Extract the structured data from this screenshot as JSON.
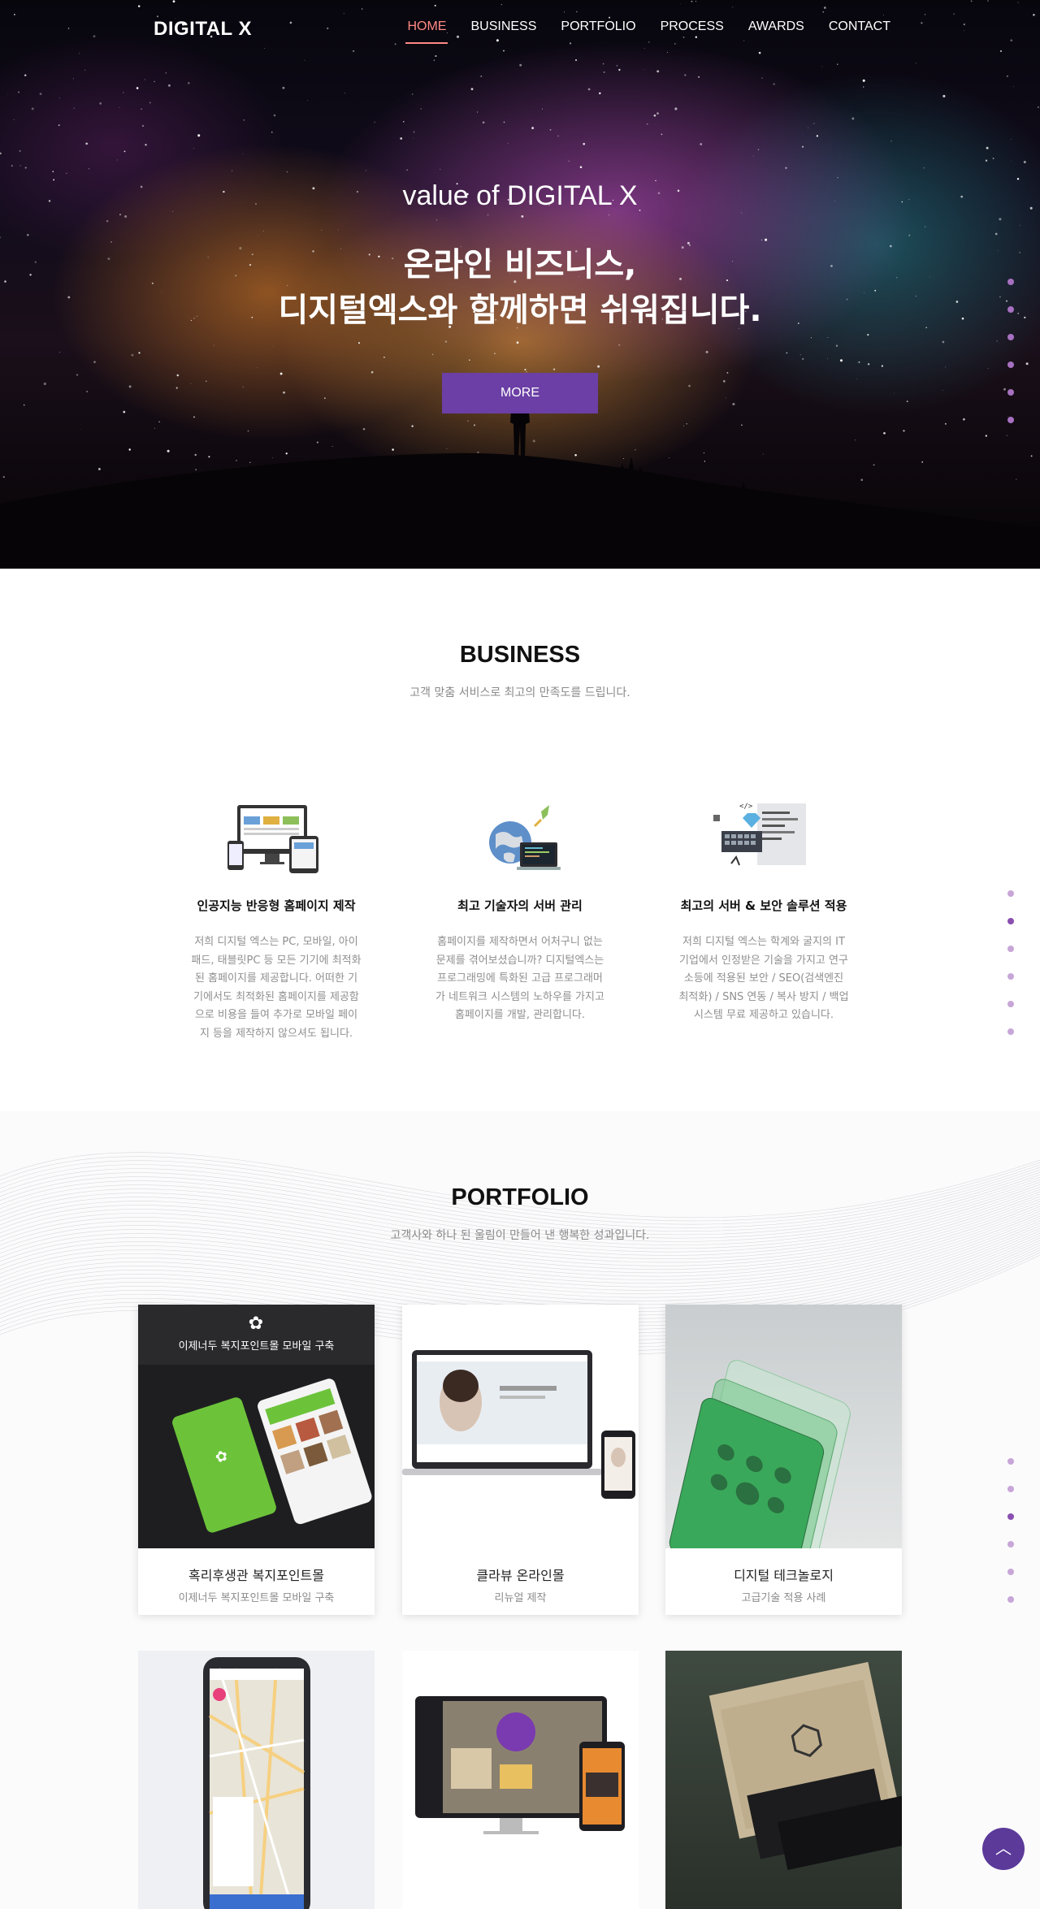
{
  "nav": {
    "logo": "DIGITAL X",
    "items": [
      {
        "label": "HOME",
        "active": true
      },
      {
        "label": "BUSINESS",
        "active": false
      },
      {
        "label": "PORTFOLIO",
        "active": false
      },
      {
        "label": "PROCESS",
        "active": false
      },
      {
        "label": "AWARDS",
        "active": false
      },
      {
        "label": "CONTACT",
        "active": false
      }
    ]
  },
  "hero": {
    "subtitle": "value of DIGITAL X",
    "title_line1": "온라인 비즈니스,",
    "title_line2": "디지털엑스와 함께하면 쉬워집니다.",
    "button": "MORE"
  },
  "business": {
    "title": "BUSINESS",
    "subtitle": "고객 맞춤 서비스로 최고의 만족도를 드립니다.",
    "cards": [
      {
        "icon": "responsive-devices-icon",
        "title": "인공지능 반응형 홈페이지 제작",
        "text": "저희 디지털 엑스는 PC, 모바일, 아이패드, 태블릿PC 등 모든 기기에 최적화된 홈페이지를 제공합니다. 어떠한 기기에서도 최적화된 홈페이지를 제공함으로 비용을 들여 추가로 모바일 페이지 등을 제작하지 않으셔도 됩니다."
      },
      {
        "icon": "globe-server-icon",
        "title": "최고 기술자의 서버 관리",
        "text": "홈페이지를 제작하면서 어처구니 없는 문제를 겪어보셨습니까? 디지털엑스는 프로그래밍에 특화된 고급 프로그래머가 네트워크 시스템의 노하우를 가지고 홈페이지를 개발, 관리합니다."
      },
      {
        "icon": "code-security-icon",
        "title": "최고의 서버 & 보안 솔루션 적용",
        "text": "저희 디지털 엑스는 학계와 굴지의 IT 기업에서 인정받은 기술을 가지고 연구소등에 적용된 보안 / SEO(검색엔진 최적화) / SNS 연동 / 복사 방지 / 백업 시스템 무료 제공하고 있습니다."
      }
    ]
  },
  "portfolio": {
    "title": "PORTFOLIO",
    "subtitle": "고객사와 하나 된 울림이 만들어 낸 행복한 성과입니다.",
    "items": [
      {
        "banner": "이제너두 복지포인트몰 모바일 구축",
        "title": "혹리후생관 복지포인트몰",
        "desc": "이제너두 복지포인트몰 모바일 구축"
      },
      {
        "title": "클라뷰 온라인몰",
        "desc": "리뉴얼 제작"
      },
      {
        "title": "디지털 테크놀로지",
        "desc": "고급기술 적용 사례"
      },
      {
        "title": "",
        "desc": ""
      },
      {
        "title": "",
        "desc": ""
      },
      {
        "title": "",
        "desc": ""
      }
    ]
  },
  "colors": {
    "accent": "#6b3fa5",
    "active_nav": "#ff8a84",
    "dot": "#c8a6d8",
    "dot_active": "#8a4fb0"
  }
}
